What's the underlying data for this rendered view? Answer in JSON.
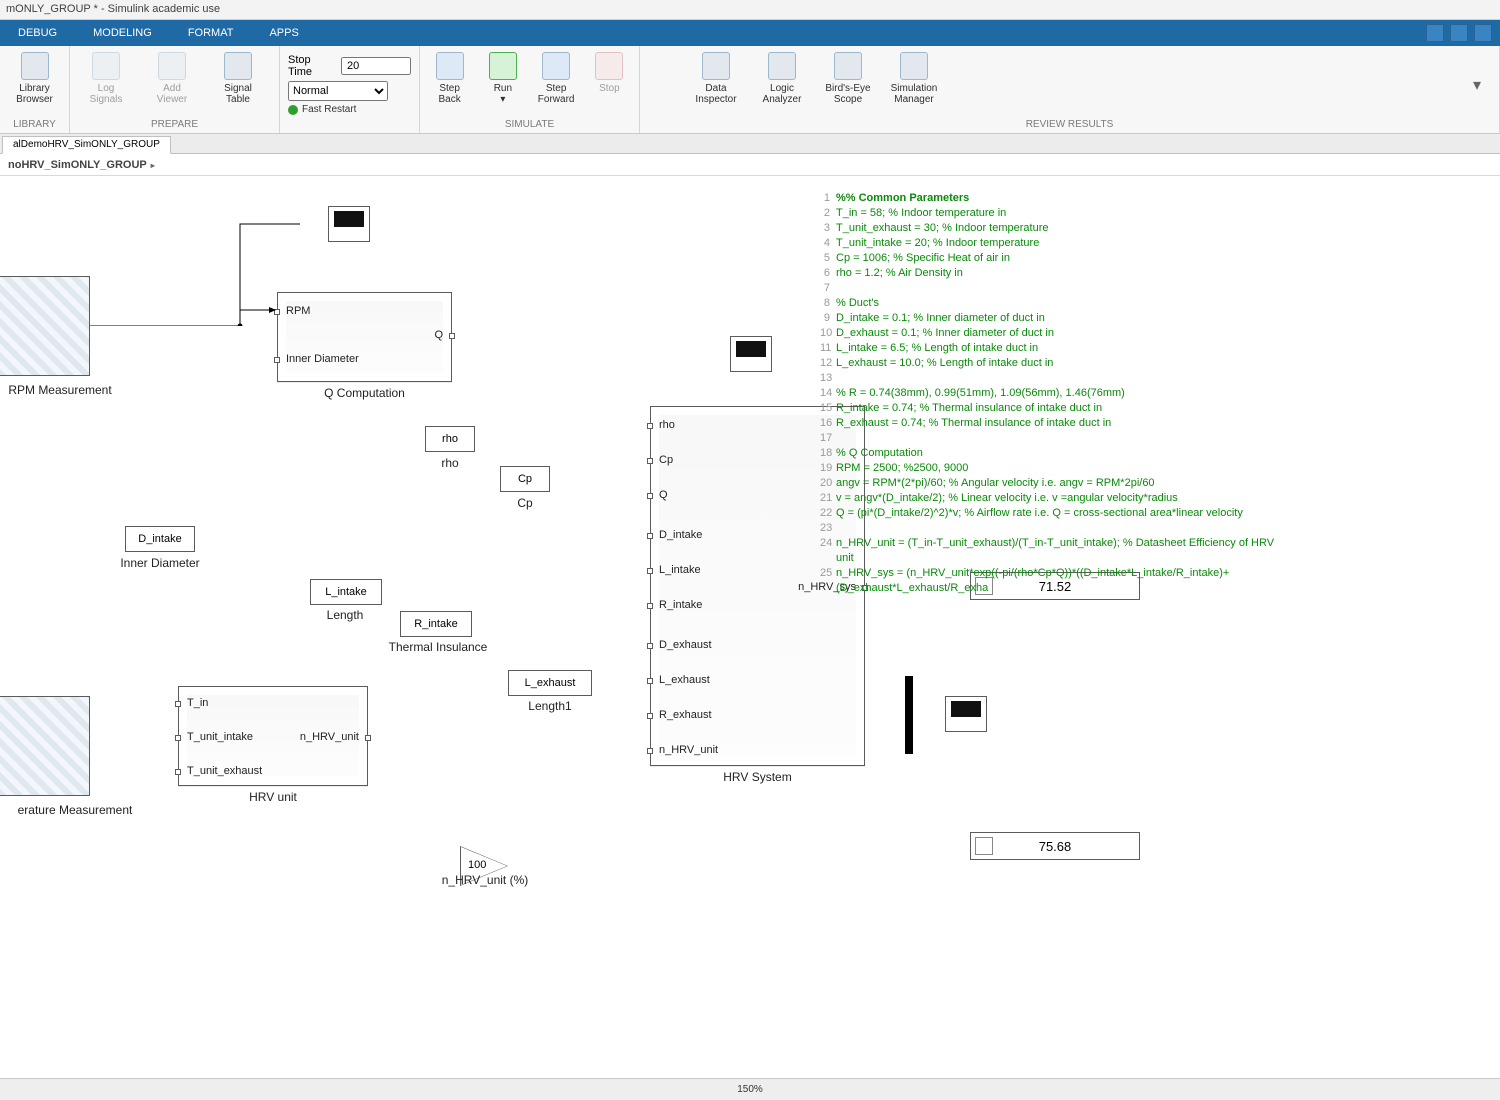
{
  "title": "mONLY_GROUP * - Simulink academic use",
  "menutabs": [
    "DEBUG",
    "MODELING",
    "FORMAT",
    "APPS"
  ],
  "ribbon": {
    "library": {
      "l1": "Library",
      "l2": "Browser",
      "group": "LIBRARY"
    },
    "prepare": {
      "log": "Log\nSignals",
      "add": "Add\nViewer",
      "table": "Signal\nTable",
      "group": "PREPARE"
    },
    "sim": {
      "stoptime_label": "Stop Time",
      "stoptime": "20",
      "mode": "Normal",
      "fast": "Fast Restart",
      "back": "Step\nBack",
      "run": "Run",
      "fwd": "Step\nForward",
      "stop": "Stop",
      "group": "SIMULATE"
    },
    "review": {
      "di": "Data\nInspector",
      "la": "Logic\nAnalyzer",
      "be": "Bird's-Eye\nScope",
      "sm": "Simulation\nManager",
      "group": "REVIEW RESULTS"
    }
  },
  "filetab": "alDemoHRV_SimONLY_GROUP",
  "crumb": "noHRV_SimONLY_GROUP",
  "blocks": {
    "rpm_img_cap": "RPM Measurement",
    "inner_dia": "D_intake",
    "inner_dia_cap": "Inner Diameter",
    "rho": "rho",
    "rho_cap": "rho",
    "cp": "Cp",
    "cp_cap": "Cp",
    "l_intake": "L_intake",
    "l_intake_cap": "Length",
    "r_intake": "R_intake",
    "r_intake_cap": "Thermal Insulance",
    "l_exhaust": "L_exhaust",
    "l_exhaust_cap": "Length1",
    "temp_cap": "erature Measurement",
    "qcomp_cap": "Q Computation",
    "qcomp_in1": "RPM",
    "qcomp_in2": "Inner Diameter",
    "qcomp_out": "Q",
    "hrvunit_cap": "HRV unit",
    "hrvunit_in1": "T_in",
    "hrvunit_in2": "T_unit_intake",
    "hrvunit_in3": "T_unit_exhaust",
    "hrvunit_out": "n_HRV_unit",
    "hrvsys_cap": "HRV System",
    "hrvsys_in": [
      "rho",
      "Cp",
      "Q",
      "D_intake",
      "L_intake",
      "R_intake",
      "D_exhaust",
      "L_exhaust",
      "R_exhaust",
      "n_HRV_unit"
    ],
    "hrvsys_out": "n_HRV_sys",
    "gain": "100",
    "gain_cap": "n_HRV_unit (%)",
    "disp1": "71.52",
    "disp2": "75.68"
  },
  "code": [
    {
      "n": 1,
      "c": "%% Common Parameters",
      "cls": "kw"
    },
    {
      "n": 2,
      "c": "T_in    = 58; % Indoor temperature in",
      "cls": "cm"
    },
    {
      "n": 3,
      "c": "T_unit_exhaust  = 30; % Indoor temperature",
      "cls": "cm"
    },
    {
      "n": 4,
      "c": "T_unit_intake   = 20; % Indoor temperature",
      "cls": "cm"
    },
    {
      "n": 5,
      "c": "Cp  = 1006; % Specific Heat of air in",
      "cls": "cm"
    },
    {
      "n": 6,
      "c": "rho = 1.2; % Air Density in",
      "cls": "cm"
    },
    {
      "n": 7,
      "c": "",
      "cls": ""
    },
    {
      "n": 8,
      "c": "% Duct's",
      "cls": "cm"
    },
    {
      "n": 9,
      "c": "D_intake   = 0.1; % Inner diameter of duct in",
      "cls": "cm"
    },
    {
      "n": 10,
      "c": "D_exhaust  = 0.1; % Inner diameter of duct in",
      "cls": "cm"
    },
    {
      "n": 11,
      "c": "L_intake   = 6.5; % Length of intake duct in",
      "cls": "cm"
    },
    {
      "n": 12,
      "c": "L_exhaust  = 10.0; % Length of intake duct in",
      "cls": "cm"
    },
    {
      "n": 13,
      "c": "",
      "cls": ""
    },
    {
      "n": 14,
      "c": "% R = 0.74(38mm), 0.99(51mm), 1.09(56mm), 1.46(76mm)",
      "cls": "cm"
    },
    {
      "n": 15,
      "c": "R_intake   = 0.74; % Thermal insulance of intake duct in",
      "cls": "cm"
    },
    {
      "n": 16,
      "c": "R_exhaust  = 0.74; % Thermal insulance of intake duct in",
      "cls": "cm"
    },
    {
      "n": 17,
      "c": "",
      "cls": ""
    },
    {
      "n": 18,
      "c": "% Q Computation",
      "cls": "cm"
    },
    {
      "n": 19,
      "c": "RPM = 2500; %2500, 9000",
      "cls": "cm"
    },
    {
      "n": 20,
      "c": "angv = RPM*(2*pi)/60; % Angular velocity i.e. angv = RPM*2pi/60",
      "cls": "cm"
    },
    {
      "n": 21,
      "c": "v = angv*(D_intake/2); % Linear velocity i.e. v =angular velocity*radius",
      "cls": "cm"
    },
    {
      "n": 22,
      "c": "Q = (pi*(D_intake/2)^2)*v; % Airflow rate i.e. Q = cross-sectional area*linear velocity",
      "cls": "cm"
    },
    {
      "n": 23,
      "c": "",
      "cls": ""
    },
    {
      "n": 24,
      "c": "n_HRV_unit = (T_in-T_unit_exhaust)/(T_in-T_unit_intake); % Datasheet Efficiency of HRV unit",
      "cls": "cm"
    },
    {
      "n": 25,
      "c": "n_HRV_sys = (n_HRV_unit*exp((-pi/(rho*Cp*Q))*((D_intake*L_intake/R_intake)+(D_exhaust*L_exhaust/R_exha",
      "cls": "cm"
    }
  ],
  "status_zoom": "150%"
}
